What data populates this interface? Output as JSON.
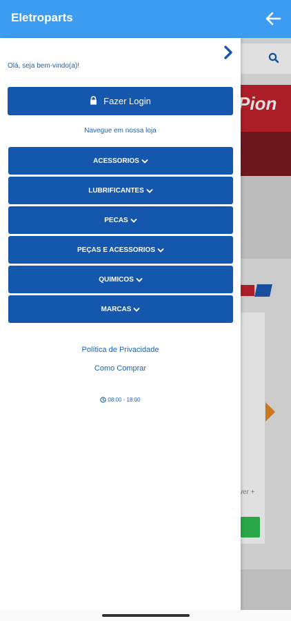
{
  "appbar": {
    "title": "Eletroparts",
    "back_icon": "arrow-left-icon"
  },
  "drawer": {
    "welcome": "Olá, seja bem-vindo(a)!",
    "login_label": "Fazer Login",
    "login_icon": "lock-icon",
    "nav_label": "Navegue em nossa loja",
    "categories": [
      {
        "label": "ACESSORIOS"
      },
      {
        "label": "LUBRIFICANTES"
      },
      {
        "label": "PECAS"
      },
      {
        "label": "PEÇAS E ACESSORIOS"
      },
      {
        "label": "QUIMICOS"
      },
      {
        "label": "MARCAS"
      }
    ],
    "links": {
      "privacy": "Política de Privacidade",
      "how_to_buy": "Como Comprar"
    },
    "hours": "08:00 - 18:00"
  },
  "background": {
    "banner_text": "Pion",
    "card_text": "ver +"
  },
  "colors": {
    "appbar": "#3b9cf1",
    "primary_button": "#1457ac",
    "link_text": "#1763b5"
  }
}
